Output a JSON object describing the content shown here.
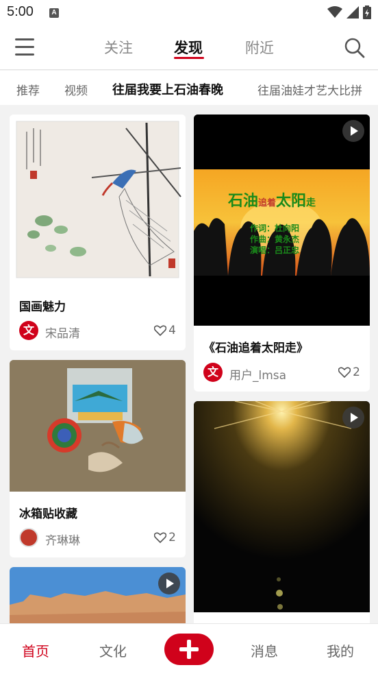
{
  "status_bar": {
    "time": "5:00",
    "indicator": "A",
    "icons": [
      "wifi-icon",
      "signal-icon",
      "battery-icon"
    ]
  },
  "top_nav": {
    "tabs": [
      "关注",
      "发现",
      "附近"
    ],
    "active_tab": "发现",
    "icons": [
      "menu-icon",
      "search-icon"
    ]
  },
  "category_tabs": {
    "items": [
      "推荐",
      "视频",
      "往届我要上石油春晚",
      "往届油娃才艺大比拼"
    ],
    "active": "往届我要上石油春晚"
  },
  "feed": {
    "left": [
      {
        "title": "国画魅力",
        "author": "宋品清",
        "likes": "4",
        "avatar_text": "文",
        "is_video": false
      },
      {
        "title": "冰箱贴收藏",
        "author": "齐琳琳",
        "likes": "2",
        "avatar_text": "",
        "is_video": false
      },
      {
        "title": "",
        "author": "",
        "likes": "",
        "is_video": true
      }
    ],
    "right": [
      {
        "title": "《石油追着太阳走》",
        "author": "用户_lmsa",
        "likes": "2",
        "avatar_text": "文",
        "is_video": true,
        "video_text": {
          "headline_a": "石油",
          "headline_b": "追着",
          "headline_c": "太阳",
          "headline_d": "走",
          "credit_1": "作词：杜向阳",
          "credit_2": "作曲：黄永杰",
          "credit_3": "演唱：吕正忠"
        }
      },
      {
        "title": "",
        "author": "",
        "likes": "",
        "is_video": true
      }
    ]
  },
  "bottom_nav": {
    "items": [
      "首页",
      "文化",
      "消息",
      "我的"
    ],
    "active": "首页",
    "add_icon": "plus-icon"
  },
  "colors": {
    "accent": "#d0021b",
    "background": "#f2f2f2",
    "card": "#ffffff"
  }
}
